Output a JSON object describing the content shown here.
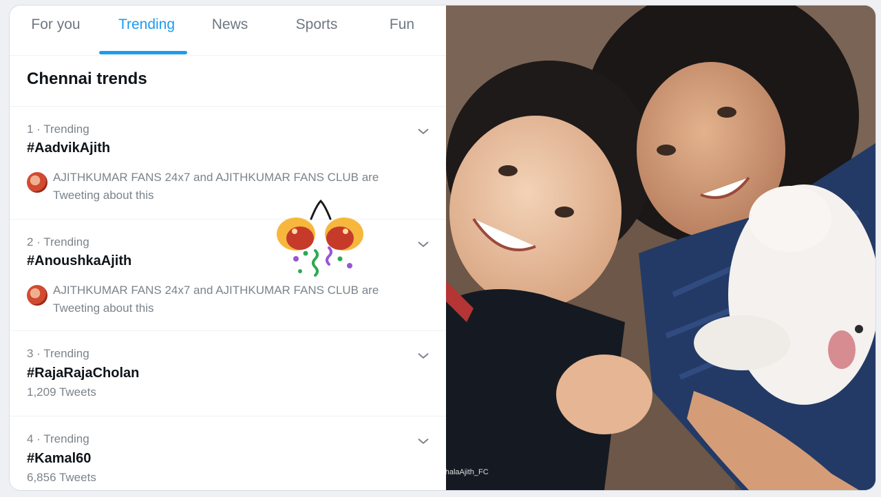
{
  "tabs": [
    {
      "label": "For you",
      "active": false
    },
    {
      "label": "Trending",
      "active": true
    },
    {
      "label": "News",
      "active": false
    },
    {
      "label": "Sports",
      "active": false
    },
    {
      "label": "Fun",
      "active": false
    }
  ],
  "section_title": "Chennai trends",
  "trends": [
    {
      "meta": "1 · Trending",
      "tag": "#AadvikAjith",
      "tweeting": "AJITHKUMAR FANS 24x7 and AJITHKUMAR FANS CLUB are Tweeting about this"
    },
    {
      "meta": "2 · Trending",
      "tag": "#AnoushkaAjith",
      "tweeting": "AJITHKUMAR FANS 24x7 and AJITHKUMAR FANS CLUB are Tweeting about this"
    },
    {
      "meta": "3 · Trending",
      "tag": "#RajaRajaCholan",
      "count": "1,209 Tweets"
    },
    {
      "meta": "4 · Trending",
      "tag": "#Kamal60",
      "count": "6,856 Tweets"
    }
  ],
  "photo": {
    "watermark": "ThalaAjith_FC"
  },
  "colors": {
    "accent": "#1d9bf0",
    "muted": "#7b838b",
    "text": "#0f1419"
  },
  "icons": [
    "chevron-down-icon",
    "party-popper-icon",
    "fan-avatar"
  ]
}
